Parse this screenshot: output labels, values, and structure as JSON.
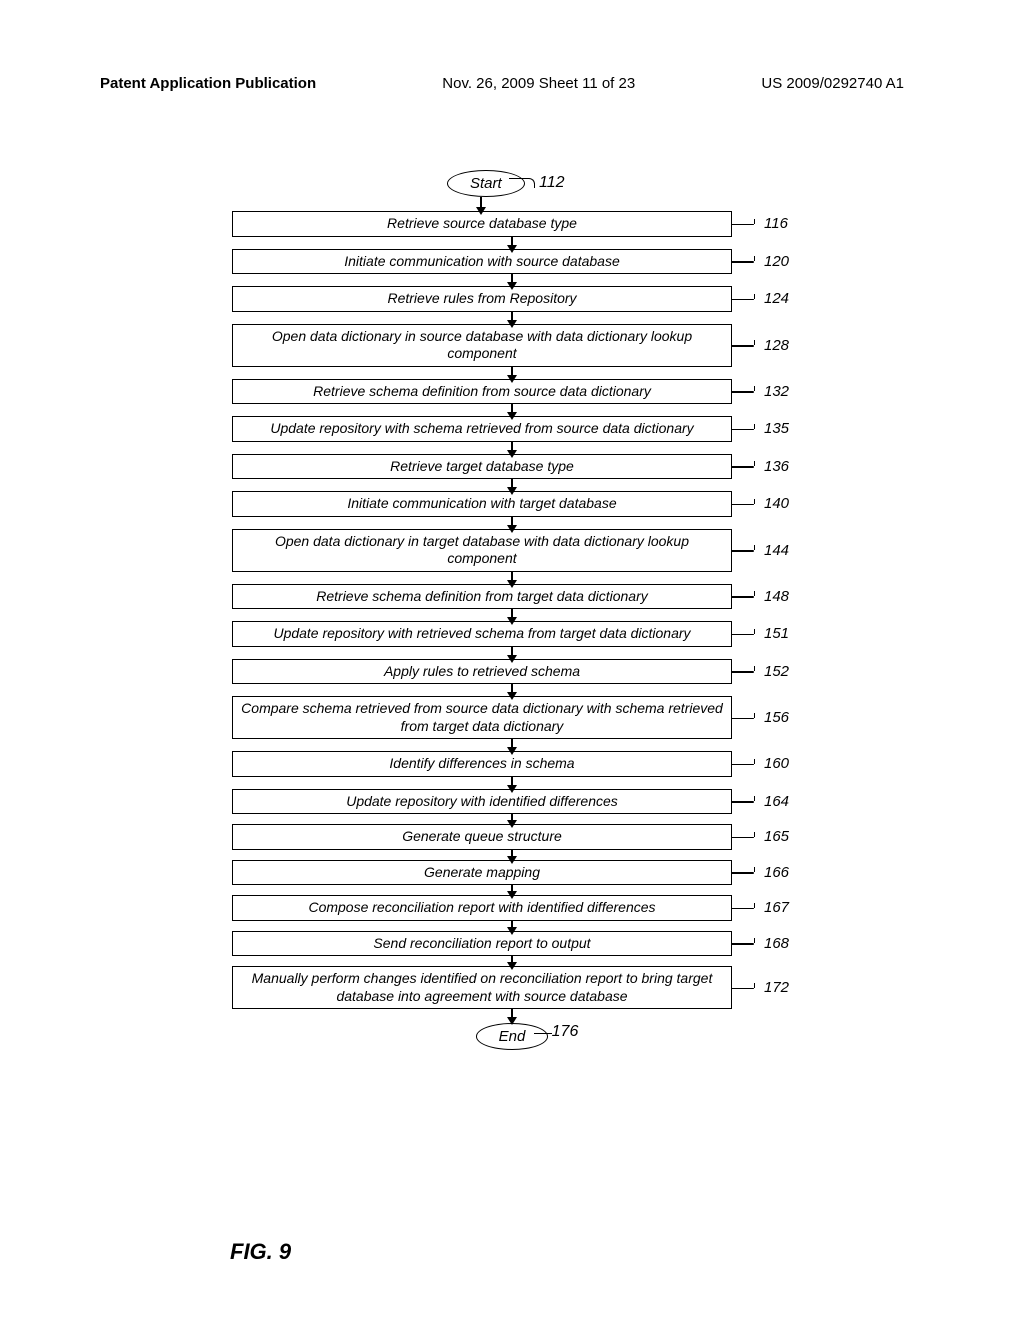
{
  "header": {
    "left": "Patent Application Publication",
    "center": "Nov. 26, 2009  Sheet 11 of 23",
    "right": "US 2009/0292740 A1"
  },
  "figure_label": "FIG. 9",
  "start": {
    "label": "Start",
    "ref": "112"
  },
  "end": {
    "label": "End",
    "ref": "176"
  },
  "steps": [
    {
      "ref": "116",
      "text": "Retrieve source database type"
    },
    {
      "ref": "120",
      "text": "Initiate communication with source database"
    },
    {
      "ref": "124",
      "text": "Retrieve rules from Repository"
    },
    {
      "ref": "128",
      "text": "Open data dictionary in source database with data dictionary lookup component"
    },
    {
      "ref": "132",
      "text": "Retrieve schema definition from source data dictionary"
    },
    {
      "ref": "135",
      "text": "Update repository with schema retrieved from source data dictionary"
    },
    {
      "ref": "136",
      "text": "Retrieve target database type"
    },
    {
      "ref": "140",
      "text": "Initiate communication with target database"
    },
    {
      "ref": "144",
      "text": "Open data dictionary in target database with data dictionary lookup component"
    },
    {
      "ref": "148",
      "text": "Retrieve schema definition from target data dictionary"
    },
    {
      "ref": "151",
      "text": "Update repository with retrieved schema from target data dictionary"
    },
    {
      "ref": "152",
      "text": "Apply rules to retrieved schema"
    },
    {
      "ref": "156",
      "text": "Compare schema retrieved from source data dictionary with schema retrieved from target data dictionary",
      "tall": true
    },
    {
      "ref": "160",
      "text": "Identify differences in schema"
    },
    {
      "ref": "164",
      "text": "Update repository with identified differences"
    },
    {
      "ref": "165",
      "text": "Generate queue structure"
    },
    {
      "ref": "166",
      "text": "Generate mapping"
    },
    {
      "ref": "167",
      "text": "Compose reconciliation report with identified differences"
    },
    {
      "ref": "168",
      "text": "Send reconciliation report to output"
    },
    {
      "ref": "172",
      "text": "Manually perform changes identified on reconciliation report to bring target database into agreement with source database",
      "tall": true
    }
  ]
}
